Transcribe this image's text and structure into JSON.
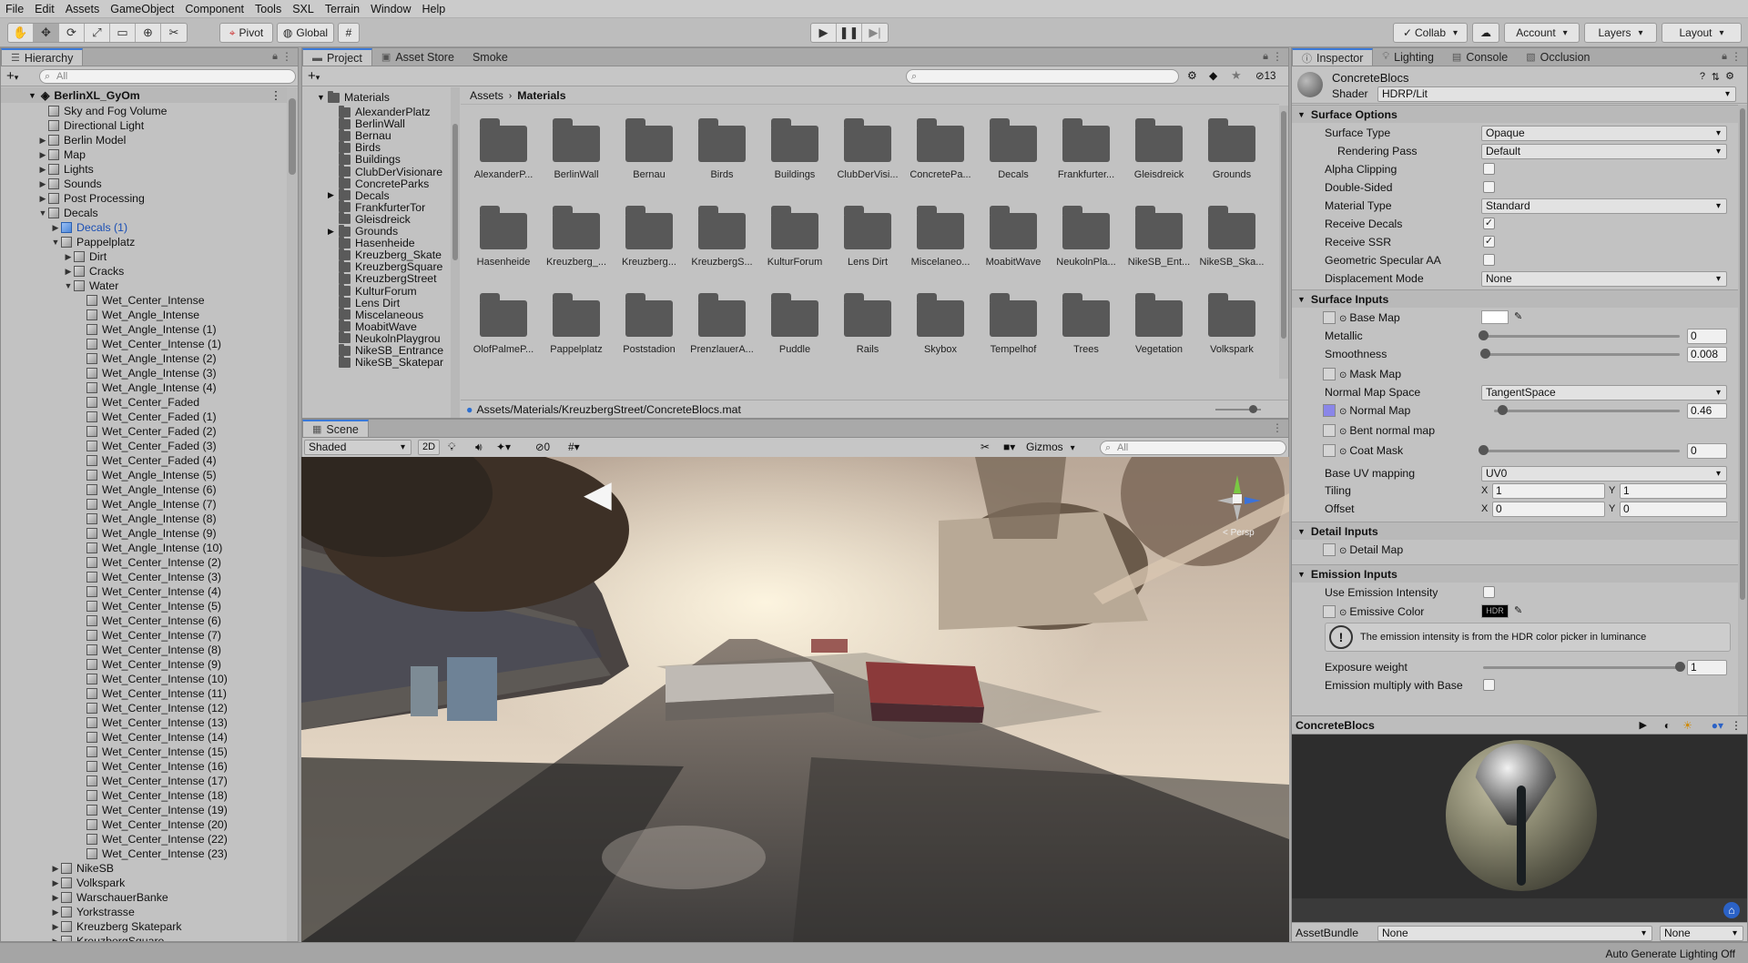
{
  "menu": [
    "File",
    "Edit",
    "Assets",
    "GameObject",
    "Component",
    "Tools",
    "SXL",
    "Terrain",
    "Window",
    "Help"
  ],
  "toolbar": {
    "tools": [
      "hand-tool",
      "move-tool",
      "rotate-tool",
      "scale-tool",
      "rect-tool",
      "transform-tool",
      "custom-tool"
    ],
    "pivot_label": "Pivot",
    "global_label": "Global",
    "collab_label": "Collab",
    "account_label": "Account",
    "layers_label": "Layers",
    "layout_label": "Layout"
  },
  "hierarchy": {
    "tab_label": "Hierarchy",
    "search_placeholder": "All",
    "scene_name": "BerlinXL_GyOm",
    "items": [
      {
        "label": "Sky and Fog Volume",
        "depth": 1,
        "arrow": ""
      },
      {
        "label": "Directional Light",
        "depth": 1,
        "arrow": ""
      },
      {
        "label": "Berlin Model",
        "depth": 1,
        "arrow": "▶"
      },
      {
        "label": "Map",
        "depth": 1,
        "arrow": "▶"
      },
      {
        "label": "Lights",
        "depth": 1,
        "arrow": "▶"
      },
      {
        "label": "Sounds",
        "depth": 1,
        "arrow": "▶"
      },
      {
        "label": "Post Processing",
        "depth": 1,
        "arrow": "▶"
      },
      {
        "label": "Decals",
        "depth": 1,
        "arrow": "▼"
      },
      {
        "label": "Decals (1)",
        "depth": 2,
        "arrow": "▶",
        "blue": true
      },
      {
        "label": "Pappelplatz",
        "depth": 2,
        "arrow": "▼"
      },
      {
        "label": "Dirt",
        "depth": 3,
        "arrow": "▶"
      },
      {
        "label": "Cracks",
        "depth": 3,
        "arrow": "▶"
      },
      {
        "label": "Water",
        "depth": 3,
        "arrow": "▼"
      },
      {
        "label": "Wet_Center_Intense",
        "depth": 4,
        "arrow": ""
      },
      {
        "label": "Wet_Angle_Intense",
        "depth": 4,
        "arrow": ""
      },
      {
        "label": "Wet_Angle_Intense (1)",
        "depth": 4,
        "arrow": ""
      },
      {
        "label": "Wet_Center_Intense (1)",
        "depth": 4,
        "arrow": ""
      },
      {
        "label": "Wet_Angle_Intense (2)",
        "depth": 4,
        "arrow": ""
      },
      {
        "label": "Wet_Angle_Intense (3)",
        "depth": 4,
        "arrow": ""
      },
      {
        "label": "Wet_Angle_Intense (4)",
        "depth": 4,
        "arrow": ""
      },
      {
        "label": "Wet_Center_Faded",
        "depth": 4,
        "arrow": ""
      },
      {
        "label": "Wet_Center_Faded (1)",
        "depth": 4,
        "arrow": ""
      },
      {
        "label": "Wet_Center_Faded (2)",
        "depth": 4,
        "arrow": ""
      },
      {
        "label": "Wet_Center_Faded (3)",
        "depth": 4,
        "arrow": ""
      },
      {
        "label": "Wet_Center_Faded (4)",
        "depth": 4,
        "arrow": ""
      },
      {
        "label": "Wet_Angle_Intense (5)",
        "depth": 4,
        "arrow": ""
      },
      {
        "label": "Wet_Angle_Intense (6)",
        "depth": 4,
        "arrow": ""
      },
      {
        "label": "Wet_Angle_Intense (7)",
        "depth": 4,
        "arrow": ""
      },
      {
        "label": "Wet_Angle_Intense (8)",
        "depth": 4,
        "arrow": ""
      },
      {
        "label": "Wet_Angle_Intense (9)",
        "depth": 4,
        "arrow": ""
      },
      {
        "label": "Wet_Angle_Intense (10)",
        "depth": 4,
        "arrow": ""
      },
      {
        "label": "Wet_Center_Intense (2)",
        "depth": 4,
        "arrow": ""
      },
      {
        "label": "Wet_Center_Intense (3)",
        "depth": 4,
        "arrow": ""
      },
      {
        "label": "Wet_Center_Intense (4)",
        "depth": 4,
        "arrow": ""
      },
      {
        "label": "Wet_Center_Intense (5)",
        "depth": 4,
        "arrow": ""
      },
      {
        "label": "Wet_Center_Intense (6)",
        "depth": 4,
        "arrow": ""
      },
      {
        "label": "Wet_Center_Intense (7)",
        "depth": 4,
        "arrow": ""
      },
      {
        "label": "Wet_Center_Intense (8)",
        "depth": 4,
        "arrow": ""
      },
      {
        "label": "Wet_Center_Intense (9)",
        "depth": 4,
        "arrow": ""
      },
      {
        "label": "Wet_Center_Intense (10)",
        "depth": 4,
        "arrow": ""
      },
      {
        "label": "Wet_Center_Intense (11)",
        "depth": 4,
        "arrow": ""
      },
      {
        "label": "Wet_Center_Intense (12)",
        "depth": 4,
        "arrow": ""
      },
      {
        "label": "Wet_Center_Intense (13)",
        "depth": 4,
        "arrow": ""
      },
      {
        "label": "Wet_Center_Intense (14)",
        "depth": 4,
        "arrow": ""
      },
      {
        "label": "Wet_Center_Intense (15)",
        "depth": 4,
        "arrow": ""
      },
      {
        "label": "Wet_Center_Intense (16)",
        "depth": 4,
        "arrow": ""
      },
      {
        "label": "Wet_Center_Intense (17)",
        "depth": 4,
        "arrow": ""
      },
      {
        "label": "Wet_Center_Intense (18)",
        "depth": 4,
        "arrow": ""
      },
      {
        "label": "Wet_Center_Intense (19)",
        "depth": 4,
        "arrow": ""
      },
      {
        "label": "Wet_Center_Intense (20)",
        "depth": 4,
        "arrow": ""
      },
      {
        "label": "Wet_Center_Intense (22)",
        "depth": 4,
        "arrow": ""
      },
      {
        "label": "Wet_Center_Intense (23)",
        "depth": 4,
        "arrow": ""
      },
      {
        "label": "NikeSB",
        "depth": 2,
        "arrow": "▶"
      },
      {
        "label": "Volkspark",
        "depth": 2,
        "arrow": "▶"
      },
      {
        "label": "WarschauerBanke",
        "depth": 2,
        "arrow": "▶"
      },
      {
        "label": "Yorkstrasse",
        "depth": 2,
        "arrow": "▶"
      },
      {
        "label": "Kreuzberg Skatepark",
        "depth": 2,
        "arrow": "▶"
      },
      {
        "label": "KreuzbergSquare",
        "depth": 2,
        "arrow": "▶"
      }
    ]
  },
  "project": {
    "tabs": [
      "Project",
      "Asset Store",
      "Smoke"
    ],
    "hidden_count": "13",
    "tree_root": "Materials",
    "tree": [
      {
        "label": "AlexanderPlatz",
        "arrow": ""
      },
      {
        "label": "BerlinWall",
        "arrow": ""
      },
      {
        "label": "Bernau",
        "arrow": ""
      },
      {
        "label": "Birds",
        "arrow": ""
      },
      {
        "label": "Buildings",
        "arrow": ""
      },
      {
        "label": "ClubDerVisionare",
        "arrow": ""
      },
      {
        "label": "ConcreteParks",
        "arrow": ""
      },
      {
        "label": "Decals",
        "arrow": "▶"
      },
      {
        "label": "FrankfurterTor",
        "arrow": ""
      },
      {
        "label": "Gleisdreick",
        "arrow": ""
      },
      {
        "label": "Grounds",
        "arrow": "▶"
      },
      {
        "label": "Hasenheide",
        "arrow": ""
      },
      {
        "label": "Kreuzberg_Skate",
        "arrow": ""
      },
      {
        "label": "KreuzbergSquare",
        "arrow": ""
      },
      {
        "label": "KreuzbergStreet",
        "arrow": ""
      },
      {
        "label": "KulturForum",
        "arrow": ""
      },
      {
        "label": "Lens Dirt",
        "arrow": ""
      },
      {
        "label": "Miscelaneous",
        "arrow": ""
      },
      {
        "label": "MoabitWave",
        "arrow": ""
      },
      {
        "label": "NeukolnPlaygrou",
        "arrow": ""
      },
      {
        "label": "NikeSB_Entrance",
        "arrow": ""
      },
      {
        "label": "NikeSB_Skatepar",
        "arrow": ""
      }
    ],
    "breadcrumb": [
      "Assets",
      "Materials"
    ],
    "grid": [
      "AlexanderP...",
      "BerlinWall",
      "Bernau",
      "Birds",
      "Buildings",
      "ClubDerVisi...",
      "ConcretePa...",
      "Decals",
      "Frankfurter...",
      "Gleisdreick",
      "Grounds",
      "Hasenheide",
      "Kreuzberg_...",
      "Kreuzberg...",
      "KreuzbergS...",
      "KulturForum",
      "Lens Dirt",
      "Miscelaneo...",
      "MoabitWave",
      "NeukolnPla...",
      "NikeSB_Ent...",
      "NikeSB_Ska...",
      "OlofPalmeP...",
      "Pappelplatz",
      "Poststadion",
      "PrenzlauerA...",
      "Puddle",
      "Rails",
      "Skybox",
      "Tempelhof",
      "Trees",
      "Vegetation",
      "Volkspark"
    ],
    "path": "Assets/Materials/KreuzbergStreet/ConcreteBlocs.mat"
  },
  "scene": {
    "tab_label": "Scene",
    "shading_mode": "Shaded",
    "mode_2d": "2D",
    "hidden_count": "0",
    "gizmos_label": "Gizmos",
    "search_placeholder": "All",
    "gizmo_label": "< Persp"
  },
  "inspector": {
    "tabs": [
      "Inspector",
      "Lighting",
      "Console",
      "Occlusion"
    ],
    "material_name": "ConcreteBlocs",
    "shader_label": "Shader",
    "shader_value": "HDRP/Lit",
    "surface_options": {
      "title": "Surface Options",
      "surface_type": {
        "label": "Surface Type",
        "value": "Opaque"
      },
      "rendering_pass": {
        "label": "Rendering Pass",
        "value": "Default"
      },
      "alpha_clipping": {
        "label": "Alpha Clipping",
        "checked": ""
      },
      "double_sided": {
        "label": "Double-Sided",
        "checked": ""
      },
      "material_type": {
        "label": "Material Type",
        "value": "Standard"
      },
      "receive_decals": {
        "label": "Receive Decals",
        "checked": "✓"
      },
      "receive_ssr": {
        "label": "Receive SSR",
        "checked": "✓"
      },
      "geometric_specular_aa": {
        "label": "Geometric Specular AA",
        "checked": ""
      },
      "displacement_mode": {
        "label": "Displacement Mode",
        "value": "None"
      }
    },
    "surface_inputs": {
      "title": "Surface Inputs",
      "base_map": "Base Map",
      "metallic": {
        "label": "Metallic",
        "value": "0",
        "fraction": 0
      },
      "smoothness": {
        "label": "Smoothness",
        "value": "0.008",
        "fraction": 0.008
      },
      "mask_map": "Mask Map",
      "normal_map_space": {
        "label": "Normal Map Space",
        "value": "TangentSpace"
      },
      "normal_map": {
        "label": "Normal Map",
        "value": "0.46",
        "fraction": 0.046
      },
      "bent_normal_map": "Bent normal map",
      "coat_mask": {
        "label": "Coat Mask",
        "value": "0",
        "fraction": 0
      },
      "base_uv_mapping": {
        "label": "Base UV mapping",
        "value": "UV0"
      },
      "tiling": {
        "label": "Tiling",
        "x": "1",
        "y": "1"
      },
      "offset": {
        "label": "Offset",
        "x": "0",
        "y": "0"
      }
    },
    "detail_inputs": {
      "title": "Detail Inputs",
      "detail_map": "Detail Map"
    },
    "emission_inputs": {
      "title": "Emission Inputs",
      "use_emission_intensity": {
        "label": "Use Emission Intensity",
        "checked": ""
      },
      "emissive_color": "Emissive Color",
      "hdr_label": "HDR",
      "info": "The emission intensity is from the HDR color picker in luminance",
      "exposure_weight": {
        "label": "Exposure weight",
        "value": "1",
        "fraction": 1
      },
      "emission_multiply": {
        "label": "Emission multiply with Base",
        "checked": ""
      }
    },
    "preview_title": "ConcreteBlocs",
    "assetbundle_label": "AssetBundle",
    "assetbundle_value": "None",
    "assetbundle_variant": "None"
  },
  "status": {
    "text": "Auto Generate Lighting Off"
  },
  "colors": {
    "accent": "#3a79d9",
    "panel": "#c2c2c2",
    "folder": "#585858"
  }
}
